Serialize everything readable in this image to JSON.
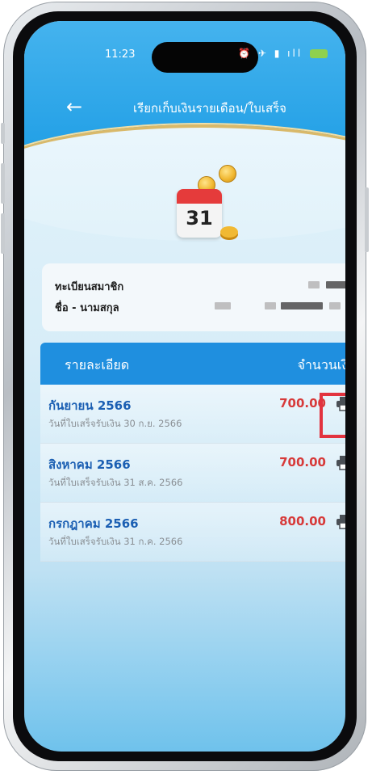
{
  "status_bar": {
    "time": "11:23",
    "icons": "⏰ ✈ ▮ ıll"
  },
  "header": {
    "back_icon": "arrow-left-icon",
    "title": "เรียกเก็บเงินรายเดือน/ใบเสร็จ"
  },
  "calendar_icon": {
    "day": "31"
  },
  "member": {
    "id_label": "ทะเบียนสมาชิก",
    "name_label": "ชื่อ - นามสกุล"
  },
  "table": {
    "col_detail": "รายละเอียด",
    "col_amount": "จำนวนเงิน",
    "rows": [
      {
        "month": "กันยายน 2566",
        "receipt": "วันที่ใบเสร็จรับเงิน 30 ก.ย. 2566",
        "amount": "700.00"
      },
      {
        "month": "สิงหาคม 2566",
        "receipt": "วันที่ใบเสร็จรับเงิน 31 ส.ค. 2566",
        "amount": "700.00"
      },
      {
        "month": "กรกฎาคม 2566",
        "receipt": "วันที่ใบเสร็จรับเงิน 31 ก.ค. 2566",
        "amount": "800.00"
      }
    ]
  },
  "colors": {
    "primary": "#1f8fdf",
    "amount": "#d73a3a",
    "month": "#1b5fb3",
    "highlight": "#e2333f"
  }
}
